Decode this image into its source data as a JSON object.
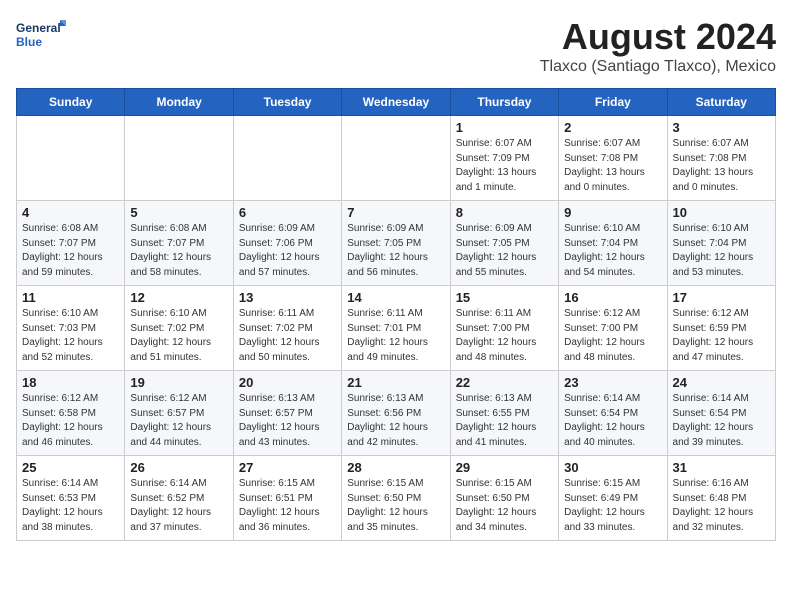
{
  "logo": {
    "line1": "General",
    "line2": "Blue"
  },
  "title": "August 2024",
  "subtitle": "Tlaxco (Santiago Tlaxco), Mexico",
  "days_of_week": [
    "Sunday",
    "Monday",
    "Tuesday",
    "Wednesday",
    "Thursday",
    "Friday",
    "Saturday"
  ],
  "weeks": [
    [
      {
        "num": "",
        "info": ""
      },
      {
        "num": "",
        "info": ""
      },
      {
        "num": "",
        "info": ""
      },
      {
        "num": "",
        "info": ""
      },
      {
        "num": "1",
        "info": "Sunrise: 6:07 AM\nSunset: 7:09 PM\nDaylight: 13 hours\nand 1 minute."
      },
      {
        "num": "2",
        "info": "Sunrise: 6:07 AM\nSunset: 7:08 PM\nDaylight: 13 hours\nand 0 minutes."
      },
      {
        "num": "3",
        "info": "Sunrise: 6:07 AM\nSunset: 7:08 PM\nDaylight: 13 hours\nand 0 minutes."
      }
    ],
    [
      {
        "num": "4",
        "info": "Sunrise: 6:08 AM\nSunset: 7:07 PM\nDaylight: 12 hours\nand 59 minutes."
      },
      {
        "num": "5",
        "info": "Sunrise: 6:08 AM\nSunset: 7:07 PM\nDaylight: 12 hours\nand 58 minutes."
      },
      {
        "num": "6",
        "info": "Sunrise: 6:09 AM\nSunset: 7:06 PM\nDaylight: 12 hours\nand 57 minutes."
      },
      {
        "num": "7",
        "info": "Sunrise: 6:09 AM\nSunset: 7:05 PM\nDaylight: 12 hours\nand 56 minutes."
      },
      {
        "num": "8",
        "info": "Sunrise: 6:09 AM\nSunset: 7:05 PM\nDaylight: 12 hours\nand 55 minutes."
      },
      {
        "num": "9",
        "info": "Sunrise: 6:10 AM\nSunset: 7:04 PM\nDaylight: 12 hours\nand 54 minutes."
      },
      {
        "num": "10",
        "info": "Sunrise: 6:10 AM\nSunset: 7:04 PM\nDaylight: 12 hours\nand 53 minutes."
      }
    ],
    [
      {
        "num": "11",
        "info": "Sunrise: 6:10 AM\nSunset: 7:03 PM\nDaylight: 12 hours\nand 52 minutes."
      },
      {
        "num": "12",
        "info": "Sunrise: 6:10 AM\nSunset: 7:02 PM\nDaylight: 12 hours\nand 51 minutes."
      },
      {
        "num": "13",
        "info": "Sunrise: 6:11 AM\nSunset: 7:02 PM\nDaylight: 12 hours\nand 50 minutes."
      },
      {
        "num": "14",
        "info": "Sunrise: 6:11 AM\nSunset: 7:01 PM\nDaylight: 12 hours\nand 49 minutes."
      },
      {
        "num": "15",
        "info": "Sunrise: 6:11 AM\nSunset: 7:00 PM\nDaylight: 12 hours\nand 48 minutes."
      },
      {
        "num": "16",
        "info": "Sunrise: 6:12 AM\nSunset: 7:00 PM\nDaylight: 12 hours\nand 48 minutes."
      },
      {
        "num": "17",
        "info": "Sunrise: 6:12 AM\nSunset: 6:59 PM\nDaylight: 12 hours\nand 47 minutes."
      }
    ],
    [
      {
        "num": "18",
        "info": "Sunrise: 6:12 AM\nSunset: 6:58 PM\nDaylight: 12 hours\nand 46 minutes."
      },
      {
        "num": "19",
        "info": "Sunrise: 6:12 AM\nSunset: 6:57 PM\nDaylight: 12 hours\nand 44 minutes."
      },
      {
        "num": "20",
        "info": "Sunrise: 6:13 AM\nSunset: 6:57 PM\nDaylight: 12 hours\nand 43 minutes."
      },
      {
        "num": "21",
        "info": "Sunrise: 6:13 AM\nSunset: 6:56 PM\nDaylight: 12 hours\nand 42 minutes."
      },
      {
        "num": "22",
        "info": "Sunrise: 6:13 AM\nSunset: 6:55 PM\nDaylight: 12 hours\nand 41 minutes."
      },
      {
        "num": "23",
        "info": "Sunrise: 6:14 AM\nSunset: 6:54 PM\nDaylight: 12 hours\nand 40 minutes."
      },
      {
        "num": "24",
        "info": "Sunrise: 6:14 AM\nSunset: 6:54 PM\nDaylight: 12 hours\nand 39 minutes."
      }
    ],
    [
      {
        "num": "25",
        "info": "Sunrise: 6:14 AM\nSunset: 6:53 PM\nDaylight: 12 hours\nand 38 minutes."
      },
      {
        "num": "26",
        "info": "Sunrise: 6:14 AM\nSunset: 6:52 PM\nDaylight: 12 hours\nand 37 minutes."
      },
      {
        "num": "27",
        "info": "Sunrise: 6:15 AM\nSunset: 6:51 PM\nDaylight: 12 hours\nand 36 minutes."
      },
      {
        "num": "28",
        "info": "Sunrise: 6:15 AM\nSunset: 6:50 PM\nDaylight: 12 hours\nand 35 minutes."
      },
      {
        "num": "29",
        "info": "Sunrise: 6:15 AM\nSunset: 6:50 PM\nDaylight: 12 hours\nand 34 minutes."
      },
      {
        "num": "30",
        "info": "Sunrise: 6:15 AM\nSunset: 6:49 PM\nDaylight: 12 hours\nand 33 minutes."
      },
      {
        "num": "31",
        "info": "Sunrise: 6:16 AM\nSunset: 6:48 PM\nDaylight: 12 hours\nand 32 minutes."
      }
    ]
  ]
}
